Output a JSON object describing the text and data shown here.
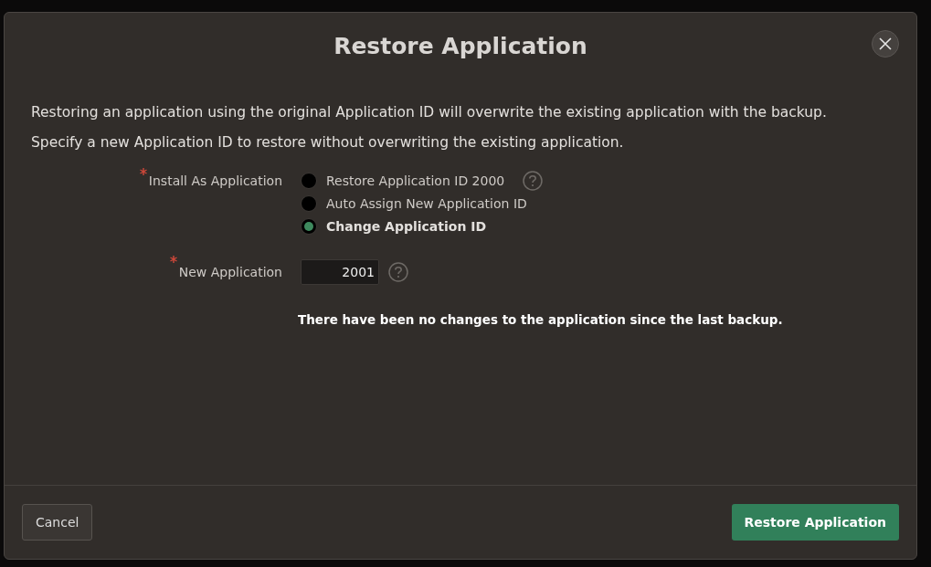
{
  "dialog": {
    "title": "Restore Application"
  },
  "intro": [
    "Restoring an application using the original Application ID will overwrite the existing application with the backup.",
    "Specify a new Application ID to restore without overwriting the existing application."
  ],
  "install_as": {
    "label": "Install As Application",
    "required": true,
    "options": [
      {
        "label": "Restore Application ID 2000",
        "selected": false
      },
      {
        "label": "Auto Assign New Application ID",
        "selected": false
      },
      {
        "label": "Change Application ID",
        "selected": true
      }
    ]
  },
  "new_application": {
    "label": "New Application",
    "required": true,
    "value": "2001"
  },
  "message": "There have been no changes to the application since the last backup.",
  "buttons": [
    {
      "label": "Cancel",
      "kind": "secondary"
    },
    {
      "label": "Restore Application",
      "kind": "primary"
    }
  ]
}
